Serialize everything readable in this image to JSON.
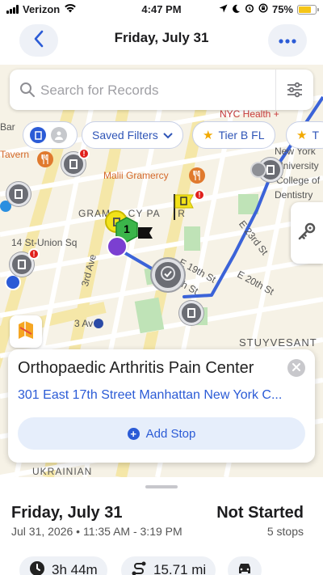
{
  "status_bar": {
    "carrier": "Verizon",
    "time": "4:47 PM",
    "battery": "75%",
    "battery_level": 0.75
  },
  "header": {
    "title": "Friday, July 31",
    "back_icon": "chevron-left-icon",
    "more_icon": "ellipsis-icon"
  },
  "search": {
    "placeholder": "Search for Records",
    "filter_icon": "sliders-icon"
  },
  "filters": {
    "saved_label": "Saved Filters",
    "tier_label": "Tier B FL",
    "partial_label": "T"
  },
  "map": {
    "labels": {
      "nyc_health": "NYC Health +",
      "bar": "Bar",
      "tavern": "Tavern",
      "new_york": "New York",
      "university": "University",
      "college_of": "College of",
      "dentistry": "Dentistry",
      "malii": "Malii Gramercy",
      "gramercy_left": "GRAM",
      "gramercy_right": "CY PA",
      "gramercy_tail": "R",
      "e23": "E 23rd St",
      "union_sq": "14 St-Union Sq",
      "third_ave": "3rd Ave",
      "e19": "E 19th St",
      "e20": "E 20th St",
      "th_st": "th St",
      "three_av": "3 Av",
      "stuyvesant": "STUYVESANT",
      "ukrainian": "UKRAINIAN"
    },
    "stop_number": "1"
  },
  "place_card": {
    "name": "Orthopaedic Arthritis Pain Center",
    "address": "301 East 17th Street Manhattan New York C...",
    "add_stop_label": "Add Stop"
  },
  "route": {
    "date": "Friday, July 31",
    "time_range": "Jul 31, 2026 • 11:35 AM -  3:19 PM",
    "status": "Not Started",
    "stops": "5 stops",
    "duration": "3h 44m",
    "distance": "15.71 mi"
  },
  "colors": {
    "accent": "#2b5bd6",
    "route_line": "#3b63d8",
    "marker_grey": "#6b6d74",
    "badge_red": "#e0201c",
    "stop_green": "#3bb54a",
    "flag_yellow": "#f2e21a",
    "purple_marker": "#7b3fd1"
  }
}
